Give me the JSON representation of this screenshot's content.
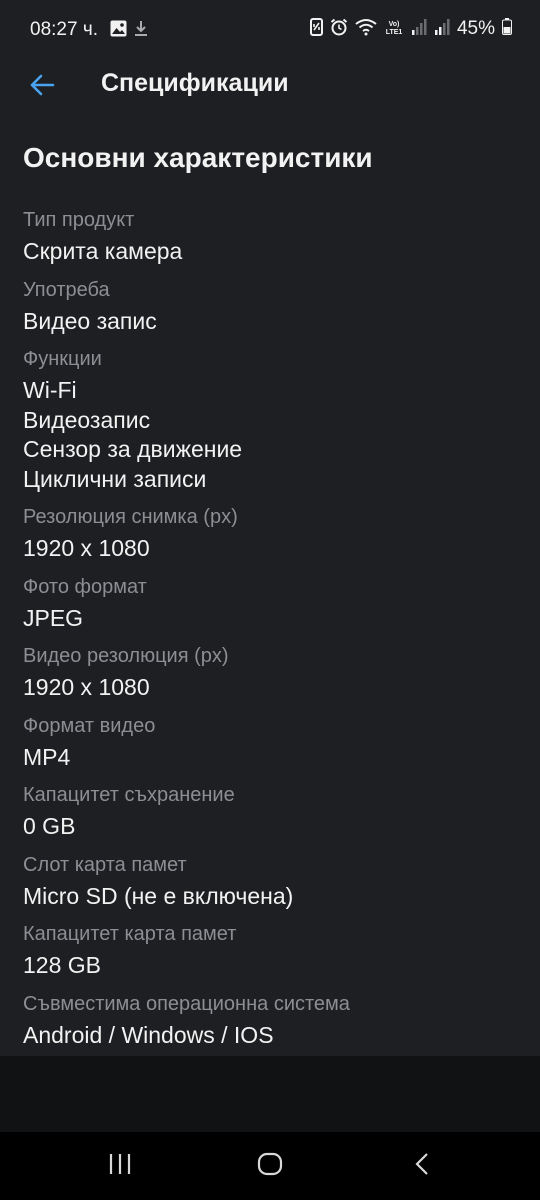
{
  "status": {
    "time": "08:27 ч.",
    "battery": "45%",
    "icons": [
      "gallery-icon",
      "download-icon",
      "nfc-icon",
      "alarm-icon",
      "wifi-icon",
      "volte-icon",
      "signal-icon",
      "signal-icon",
      "battery-icon"
    ]
  },
  "header": {
    "title": "Спецификации",
    "back_icon": "arrow-left-icon"
  },
  "section": {
    "title": "Основни характеристики",
    "specs": [
      {
        "label": "Тип продукт",
        "value": "Скрита камера"
      },
      {
        "label": "Употреба",
        "value": "Видео запис"
      },
      {
        "label": "Функции",
        "value": "Wi-Fi\nВидеозапис\nСензор за движение\nЦиклични записи"
      },
      {
        "label": "Резолюция снимка (px)",
        "value": "1920 x 1080"
      },
      {
        "label": "Фото формат",
        "value": "JPEG"
      },
      {
        "label": "Видео резолюция (px)",
        "value": "1920 x 1080"
      },
      {
        "label": "Формат видео",
        "value": "MP4"
      },
      {
        "label": "Капацитет съхранение",
        "value": "0 GB"
      },
      {
        "label": "Слот карта памет",
        "value": "Micro SD (не е включена)"
      },
      {
        "label": "Капацитет карта памет",
        "value": "128 GB"
      },
      {
        "label": "Съвместима операционна система",
        "value": "Android / Windows / IOS"
      }
    ]
  },
  "colors": {
    "accent": "#4aa3f0",
    "background": "#111214",
    "surface": "#1e1f22",
    "label": "#8c8e93",
    "text": "#f2f2f2"
  },
  "nav": [
    "recent-apps-icon",
    "home-icon",
    "back-icon"
  ]
}
